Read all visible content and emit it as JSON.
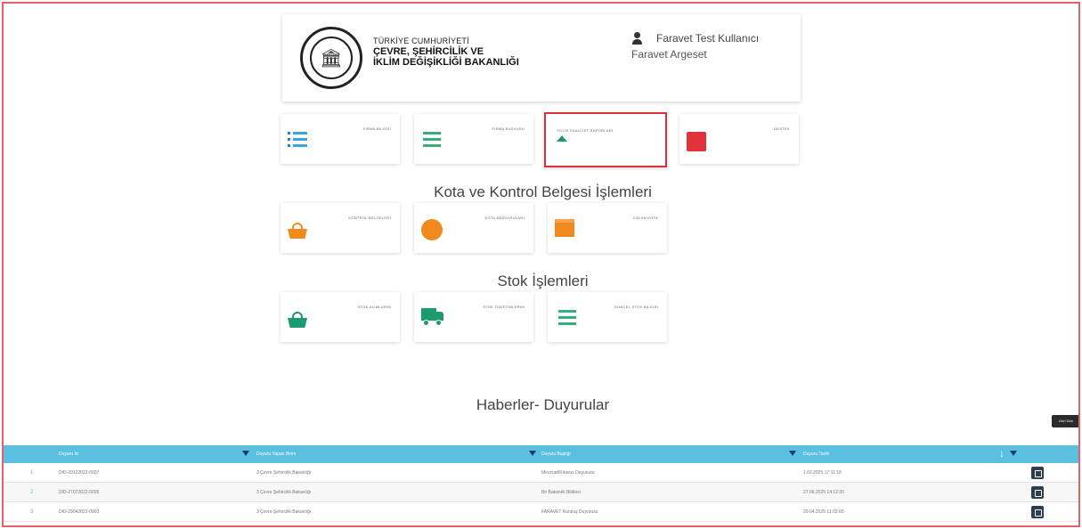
{
  "header": {
    "ministry_line1": "TÜRKİYE CUMHURİYETİ",
    "ministry_line2": "ÇEVRE, ŞEHİRCİLİK VE",
    "ministry_line3": "İKLİM DEĞİŞİKLİĞİ BAKANLIĞI",
    "user_name": "Faravet Test Kullanıcı",
    "company": "Faravet Argeset"
  },
  "tiles_main": [
    {
      "label": "FİRMA BİLGİSİ",
      "icon": "list-icon"
    },
    {
      "label": "FİRMA BAŞVURU",
      "icon": "bars-icon"
    },
    {
      "label": "YILLIK FAALİYET RAPORLARI",
      "icon": "triangle-icon"
    },
    {
      "label": "DESTEK",
      "icon": "support-icon"
    }
  ],
  "section_kota": "Kota ve Kontrol Belgesi İşlemleri",
  "tiles_kota": [
    {
      "label": "KONTROL BELGELERİ",
      "icon": "basket-icon"
    },
    {
      "label": "KOTA BAŞVURULARI",
      "icon": "circle-icon"
    },
    {
      "label": "KALAN KOTA",
      "icon": "box-icon"
    }
  ],
  "section_stok": "Stok İşlemleri",
  "tiles_stok": [
    {
      "label": "STOK ALIMLARIM",
      "icon": "basket-icon"
    },
    {
      "label": "STOK TÜKETİMLERİM",
      "icon": "truck-icon"
    },
    {
      "label": "GÜNCEL STOK BİLGİSİ",
      "icon": "bars-icon"
    }
  ],
  "section_news": "Haberler- Duyurular",
  "tooltip": "Geri Dön",
  "table": {
    "columns": [
      "Duyuru Id",
      "Duyuru Yapan Birim",
      "Duyuru Başlığı",
      "Duyuru Tarihi"
    ],
    "rows": [
      {
        "idx": "1",
        "id": "DID-20122022-0007",
        "unit": "3 Çevre Şehircilik Bakanlığı",
        "title": "Mevzuat/Kılavuz Duyurusu",
        "date": "1.02.2025 17:11:18"
      },
      {
        "idx": "2",
        "id": "DID-27072022-0005",
        "unit": "3 Çevre Şehircilik Bakanlığı",
        "title": "Bir Bakanlık Bildirisi",
        "date": "27.06.2025 14:12:30"
      },
      {
        "idx": "3",
        "id": "DID-29042022-0003",
        "unit": "3 Çevre Şehircilik Bakanlığı",
        "title": "FARAVET Kuruluş Duyurusu",
        "date": "29.04.2025 11:03:00"
      }
    ]
  },
  "colors": {
    "accent": "#5bbfe0",
    "selected_border": "#d9313a",
    "frame": "#e2626a"
  }
}
